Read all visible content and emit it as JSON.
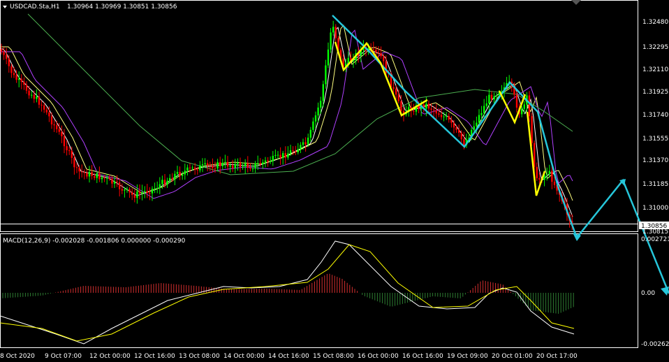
{
  "window": {
    "symbol_title": "USDCAD.Sta,H1",
    "ohlc": "1.30964 1.30969 1.30851 1.30856",
    "menu_icon": "triangle-down-icon"
  },
  "price_axis": {
    "labels": [
      "1.32480",
      "1.32295",
      "1.32110",
      "1.31925",
      "1.31740",
      "1.31555",
      "1.31370",
      "1.31185",
      "1.31000",
      "1.30815"
    ],
    "current_price": "1.30856"
  },
  "macd": {
    "title": "MACD(12,26,9) -0.002028 -0.001806 0.000000 -0.000290",
    "axis_labels": [
      "0.002721",
      "0.00",
      "-0.002623"
    ]
  },
  "time_axis": {
    "labels": [
      "8 Oct 2020",
      "9 Oct 07:00",
      "12 Oct 00:00",
      "12 Oct 16:00",
      "13 Oct 08:00",
      "14 Oct 00:00",
      "14 Oct 16:00",
      "15 Oct 08:00",
      "16 Oct 00:00",
      "16 Oct 16:00",
      "19 Oct 09:00",
      "20 Oct 01:00",
      "20 Oct 17:00"
    ]
  },
  "colors": {
    "background": "#000000",
    "bull_candle": "#00ff00",
    "bear_candle": "#ff0000",
    "zigzag_cyan": "#26c6da",
    "zigzag_yellow": "#ffff00",
    "ma_white": "#ffffff",
    "ma_yellow": "#ffff80",
    "ma_violet": "#b040ff",
    "ma_green": "#4caf50",
    "hist_pos": "#d32f2f",
    "hist_neg": "#2e7d32"
  }
}
